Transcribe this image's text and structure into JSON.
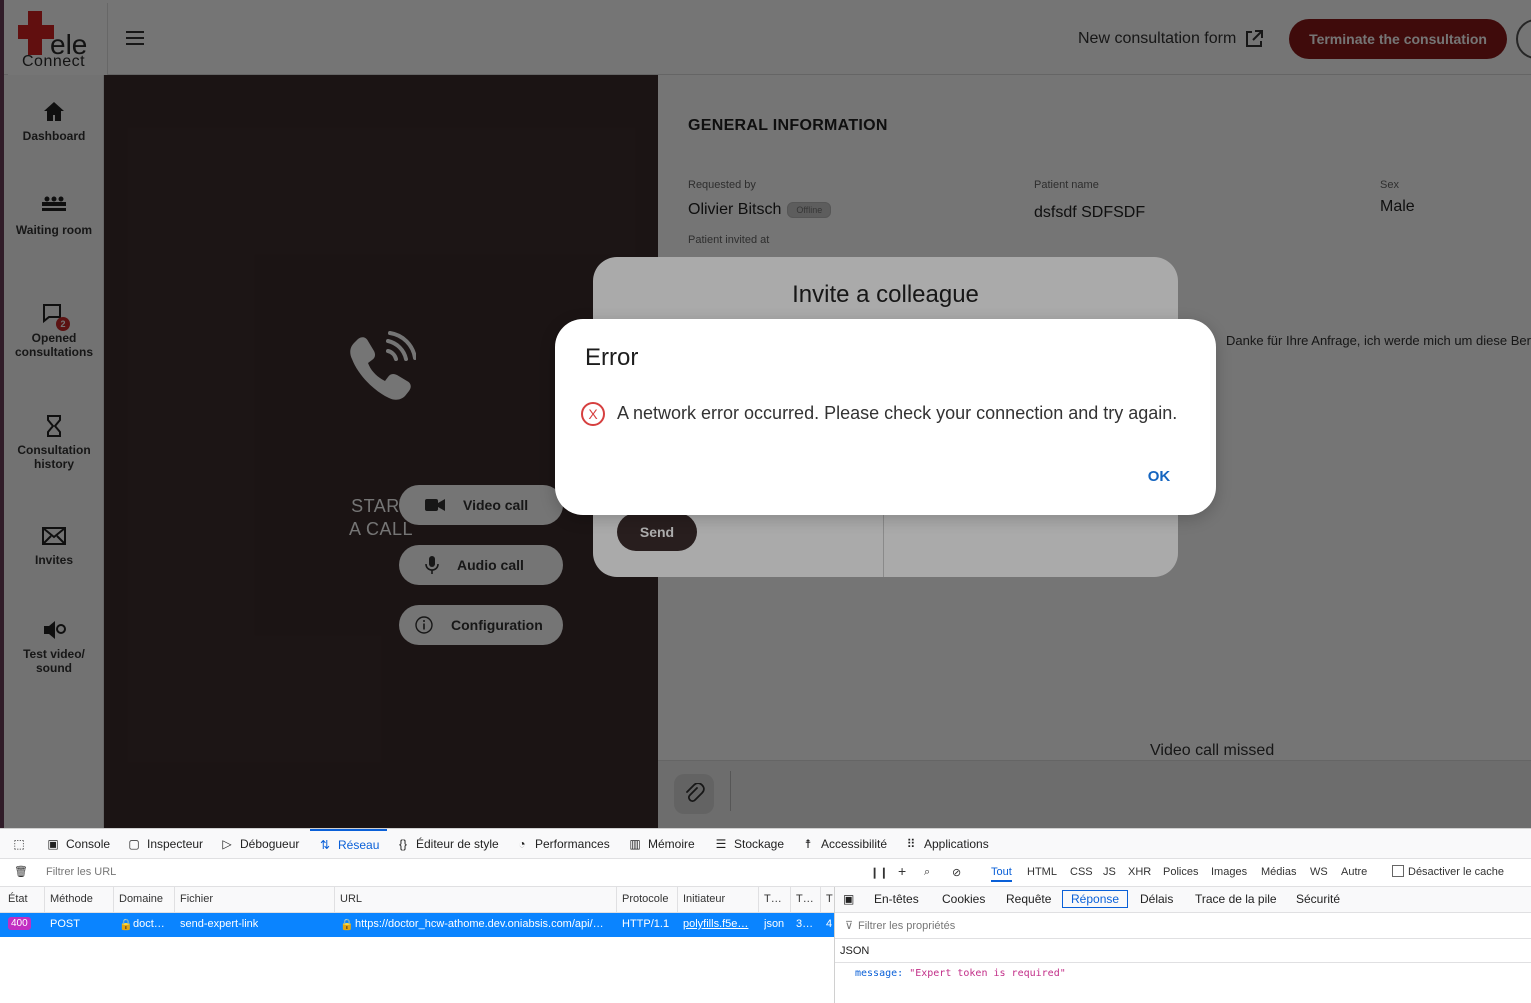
{
  "header": {
    "logo_ele": "ele",
    "logo_connect": "Connect",
    "new_form_label": "New consultation form",
    "terminate_label": "Terminate the consultation"
  },
  "sidebar": {
    "items": [
      {
        "label": "Dashboard",
        "icon": "home-icon"
      },
      {
        "label": "Waiting room",
        "icon": "waiting-room-icon"
      },
      {
        "label": "Opened consultations",
        "icon": "chat-icon",
        "badge": "2"
      },
      {
        "label": "Consultation history",
        "icon": "hourglass-icon"
      },
      {
        "label": "Invites",
        "icon": "envelope-icon"
      },
      {
        "label": "Test video/ sound",
        "icon": "speaker-icon"
      }
    ]
  },
  "call_panel": {
    "start_line1": "START",
    "start_line2": "A CALL",
    "video_call": "Video call",
    "audio_call": "Audio call",
    "configuration": "Configuration"
  },
  "general_info": {
    "title": "GENERAL INFORMATION",
    "requested_by_label": "Requested by",
    "requested_by": "Olivier Bitsch",
    "offline_badge": "Offline",
    "patient_name_label": "Patient name",
    "patient_name": "dsfsdf SDFSDF",
    "sex_label": "Sex",
    "sex": "Male",
    "invited_at_label": "Patient invited at"
  },
  "chat": {
    "message": "Danke für Ihre Anfrage, ich werde mich um diese Bera",
    "missed": "Video call missed"
  },
  "invite_dialog": {
    "title": "Invite a colleague",
    "send": "Send"
  },
  "error_dialog": {
    "title": "Error",
    "message": "A network error occurred. Please check your connection and try again.",
    "ok": "OK"
  },
  "devtools": {
    "tabs": [
      "Console",
      "Inspecteur",
      "Débogueur",
      "Réseau",
      "Éditeur de style",
      "Performances",
      "Mémoire",
      "Stockage",
      "Accessibilité",
      "Applications"
    ],
    "filter_placeholder": "Filtrer les URL",
    "type_filters": [
      "Tout",
      "HTML",
      "CSS",
      "JS",
      "XHR",
      "Polices",
      "Images",
      "Médias",
      "WS",
      "Autre"
    ],
    "disable_cache": "Désactiver le cache",
    "columns": [
      "État",
      "Méthode",
      "Domaine",
      "Fichier",
      "URL",
      "Protocole",
      "Initiateur",
      "T…",
      "T…",
      "T"
    ],
    "request": {
      "status": "400",
      "method": "POST",
      "domain": "doct…",
      "file": "send-expert-link",
      "url": "https://doctor_hcw-athome.dev.oniabsis.com/api/…",
      "protocol": "HTTP/1.1",
      "initiator": "polyfills.f5e…",
      "type": "json",
      "transferred": "3…",
      "size": "4"
    },
    "side_tabs": [
      "En-têtes",
      "Cookies",
      "Requête",
      "Réponse",
      "Délais",
      "Trace de la pile",
      "Sécurité"
    ],
    "prop_filter_placeholder": "Filtrer les propriétés",
    "json_label": "JSON",
    "json_key": "message:",
    "json_value": "\"Expert token is required\""
  }
}
